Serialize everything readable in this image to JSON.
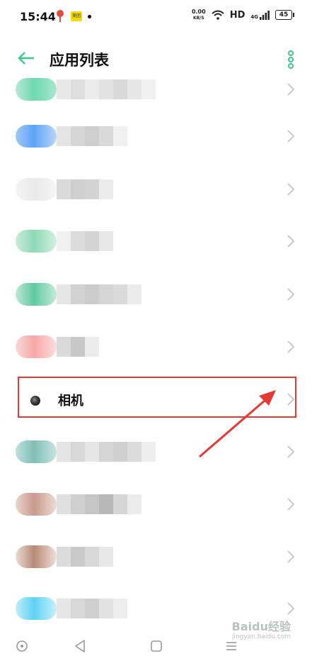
{
  "status_bar": {
    "time": "15:44",
    "badge_text": "美团",
    "net_speed_value": "0.00",
    "net_speed_unit": "KB/S",
    "hd_label": "HD",
    "signal_label": "4G",
    "battery_level": "45"
  },
  "header": {
    "title": "应用列表",
    "accent_color": "#3ec78b"
  },
  "app_list": {
    "visible_label": "相机"
  },
  "colors": {
    "highlight": "#e53935",
    "chevron": "#c4c4c4"
  },
  "watermark": {
    "logo_text": "Baidu经验",
    "sub_text": "jingyan.baidu.com"
  },
  "icons": {
    "back": "arrow-left-icon",
    "more": "vertical-dots-icon",
    "chevron": "chevron-right-icon",
    "nav_home": "circle-icon",
    "nav_back": "triangle-back-icon",
    "nav_recent": "square-icon",
    "nav_menu": "menu-lines-icon"
  }
}
